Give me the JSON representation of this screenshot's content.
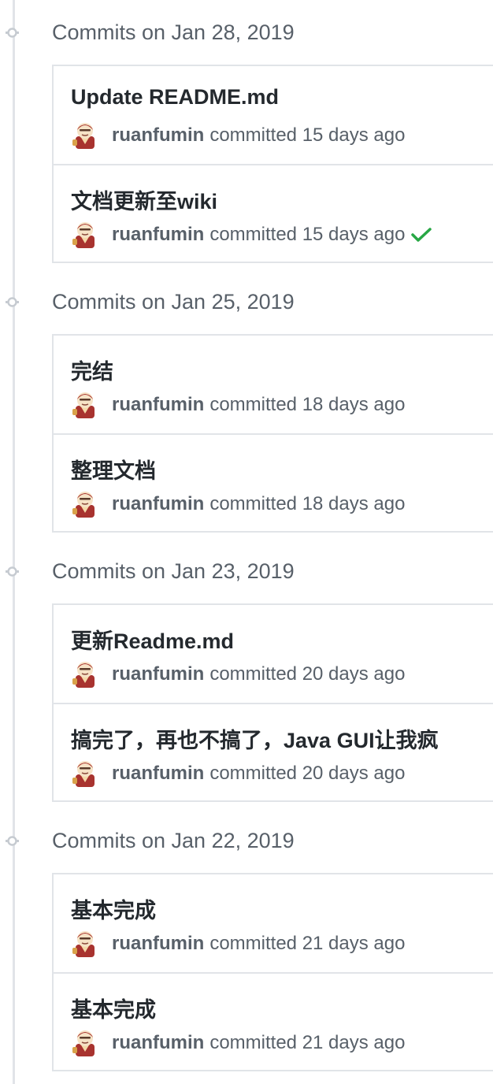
{
  "groups": [
    {
      "date_label": "Commits on Jan 28, 2019",
      "commits": [
        {
          "title": "Update README.md",
          "author": "ruanfumin",
          "time": "committed 15 days ago",
          "status": ""
        },
        {
          "title": "文档更新至wiki",
          "author": "ruanfumin",
          "time": "committed 15 days ago",
          "status": "success"
        }
      ]
    },
    {
      "date_label": "Commits on Jan 25, 2019",
      "commits": [
        {
          "title": "完结",
          "author": "ruanfumin",
          "time": "committed 18 days ago",
          "status": ""
        },
        {
          "title": "整理文档",
          "author": "ruanfumin",
          "time": "committed 18 days ago",
          "status": ""
        }
      ]
    },
    {
      "date_label": "Commits on Jan 23, 2019",
      "commits": [
        {
          "title": "更新Readme.md",
          "author": "ruanfumin",
          "time": "committed 20 days ago",
          "status": ""
        },
        {
          "title": "搞完了，再也不搞了，Java GUI让我疯",
          "author": "ruanfumin",
          "time": "committed 20 days ago",
          "status": ""
        }
      ]
    },
    {
      "date_label": "Commits on Jan 22, 2019",
      "commits": [
        {
          "title": "基本完成",
          "author": "ruanfumin",
          "time": "committed 21 days ago",
          "status": ""
        },
        {
          "title": "基本完成",
          "author": "ruanfumin",
          "time": "committed 21 days ago",
          "status": ""
        }
      ]
    }
  ],
  "icons": {
    "timeline": "git-commit-icon",
    "avatar": "avatar",
    "status_success": "check-icon"
  },
  "colors": {
    "status_success": "#28a745",
    "muted_text": "#586069",
    "border": "#e1e4e8"
  }
}
